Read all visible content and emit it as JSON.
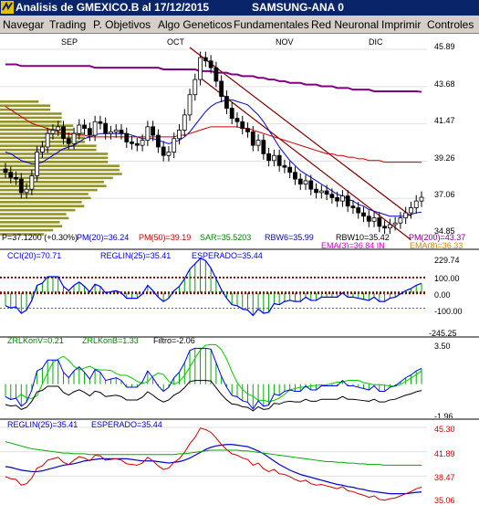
{
  "window": {
    "title": "Analisis de GMEXICO.B al 17/12/2015",
    "subtitle": "SAMSUNG-ANA 0"
  },
  "menu": [
    "Navegar",
    "Trading",
    "P. Objetivos",
    "Algo Geneticos",
    "Fundamentales",
    "Red Neuronal",
    "Imprimir",
    "Controles"
  ],
  "months": [
    "SEP",
    "OCT",
    "NOV",
    "DIC"
  ],
  "price_panel": {
    "y_ticks": [
      "45.89",
      "43.68",
      "41.47",
      "39.26",
      "37.06",
      "34.85"
    ],
    "info_row": [
      "P=37.1200 (+0.30%)",
      "PM(20)=36.24",
      "PM(50)=39.19",
      "SAR=35.5203",
      "RBW6=35.99",
      "RBW10=35.42",
      "PM(200)=43.37"
    ],
    "info_row2": [
      "EMA(3)=36.84 IN",
      "EMA(8)=36.33"
    ]
  },
  "cci_panel": {
    "labels": [
      "CCI(20)=70.71",
      "REGLIN(25)=35.41",
      "ESPERADO=35.44"
    ],
    "y_ticks": [
      "229.74",
      "100.00",
      "0.00",
      "-100.00",
      "-245.25"
    ]
  },
  "zrl_panel": {
    "labels": [
      "ZRLKonV=0.21",
      "ZRLKonB=1.33",
      "Filtro=-2.06"
    ],
    "y_ticks": [
      "3.50",
      "-1.96"
    ]
  },
  "reg_panel": {
    "labels": [
      "REGLIN(25)=35.41",
      "ESPERADO=35.44"
    ],
    "y_ticks": [
      "45.30",
      "41.89",
      "38.47",
      "35.06"
    ]
  },
  "chart_data": {
    "type": "line",
    "title": "Analisis de GMEXICO.B al 17/12/2015",
    "x_labels": [
      "SEP",
      "OCT",
      "NOV",
      "DIC"
    ],
    "ylim": [
      34.85,
      45.89
    ],
    "close": [
      38.6,
      38.3,
      38.2,
      37.4,
      37.6,
      38.4,
      39.8,
      40.1,
      40.9,
      41.1,
      41.3,
      40.6,
      40.3,
      40.9,
      41.4,
      41.2,
      40.8,
      41.6,
      41.5,
      40.9,
      41.0,
      41.1,
      40.9,
      40.4,
      40.3,
      40.2,
      40.5,
      41.3,
      40.8,
      40.1,
      39.6,
      39.8,
      40.6,
      41.1,
      42.0,
      43.2,
      44.1,
      45.4,
      45.2,
      44.8,
      44.0,
      43.1,
      42.4,
      41.8,
      41.6,
      41.2,
      41.0,
      40.2,
      40.5,
      39.7,
      39.3,
      39.6,
      39.0,
      38.9,
      38.6,
      38.2,
      37.9,
      38.1,
      37.6,
      37.4,
      37.5,
      37.3,
      37.1,
      36.9,
      37.2,
      36.6,
      36.5,
      36.2,
      36.0,
      35.7,
      35.9,
      35.4,
      35.3,
      35.5,
      35.6,
      35.9,
      36.2,
      36.5,
      36.9,
      37.12
    ],
    "series": [
      {
        "name": "PM(20)",
        "color": "#0000cc",
        "values": [
          39.8,
          39.7,
          39.5,
          39.3,
          39.2,
          39.1,
          39.1,
          39.2,
          39.4,
          39.6,
          39.8,
          40.0,
          40.1,
          40.2,
          40.4,
          40.6,
          40.7,
          40.8,
          40.9,
          40.9,
          40.9,
          40.9,
          40.9,
          40.9,
          40.8,
          40.7,
          40.6,
          40.6,
          40.6,
          40.5,
          40.4,
          40.3,
          40.4,
          40.5,
          40.7,
          41.0,
          41.4,
          41.8,
          42.2,
          42.5,
          42.7,
          42.8,
          42.9,
          42.9,
          42.8,
          42.7,
          42.6,
          42.3,
          42.0,
          41.6,
          41.1,
          40.6,
          40.1,
          39.7,
          39.3,
          39.0,
          38.7,
          38.5,
          38.3,
          38.1,
          37.9,
          37.7,
          37.5,
          37.3,
          37.2,
          37.0,
          36.9,
          36.7,
          36.6,
          36.4,
          36.3,
          36.2,
          36.1,
          36.0,
          36.0,
          36.0,
          36.0,
          36.1,
          36.2,
          36.24
        ]
      },
      {
        "name": "PM(50)",
        "color": "#cc0000",
        "values": [
          42.5,
          42.3,
          42.1,
          41.9,
          41.7,
          41.5,
          41.4,
          41.3,
          41.2,
          41.1,
          41.0,
          40.9,
          40.9,
          40.8,
          40.8,
          40.8,
          40.7,
          40.7,
          40.7,
          40.7,
          40.7,
          40.7,
          40.7,
          40.7,
          40.7,
          40.7,
          40.7,
          40.7,
          40.7,
          40.7,
          40.7,
          40.7,
          40.7,
          40.8,
          40.8,
          40.9,
          41.0,
          41.1,
          41.2,
          41.3,
          41.3,
          41.3,
          41.3,
          41.3,
          41.3,
          41.2,
          41.2,
          41.1,
          41.0,
          40.9,
          40.8,
          40.7,
          40.6,
          40.5,
          40.4,
          40.3,
          40.2,
          40.1,
          40.0,
          39.9,
          39.8,
          39.7,
          39.7,
          39.6,
          39.6,
          39.5,
          39.5,
          39.4,
          39.4,
          39.3,
          39.3,
          39.3,
          39.2,
          39.2,
          39.2,
          39.2,
          39.2,
          39.2,
          39.2,
          39.19
        ]
      },
      {
        "name": "PM(200)",
        "color": "#800080",
        "values": [
          45.0,
          45.0,
          45.0,
          44.9,
          44.9,
          44.9,
          44.9,
          44.9,
          44.9,
          44.9,
          44.9,
          44.9,
          44.9,
          44.9,
          44.9,
          44.9,
          44.9,
          44.8,
          44.8,
          44.8,
          44.8,
          44.8,
          44.8,
          44.8,
          44.8,
          44.8,
          44.8,
          44.8,
          44.8,
          44.8,
          44.7,
          44.7,
          44.7,
          44.7,
          44.7,
          44.7,
          44.7,
          44.6,
          44.6,
          44.6,
          44.5,
          44.5,
          44.5,
          44.4,
          44.4,
          44.3,
          44.3,
          44.3,
          44.2,
          44.2,
          44.1,
          44.1,
          44.0,
          44.0,
          43.9,
          43.9,
          43.9,
          43.8,
          43.8,
          43.8,
          43.7,
          43.7,
          43.7,
          43.6,
          43.6,
          43.6,
          43.5,
          43.5,
          43.5,
          43.5,
          43.4,
          43.4,
          43.4,
          43.4,
          43.4,
          43.4,
          43.4,
          43.4,
          43.4,
          43.37
        ]
      }
    ]
  },
  "colors": {
    "title_bg": "#0a246a",
    "menu_bg": "#d4d0c8",
    "volume_profile": "#808000",
    "channel": "#800000",
    "ma20": "#0000cc",
    "ma50": "#cc0000",
    "ma200": "#800080",
    "cci_line": "#0000ff",
    "zrl_green": "#00aa00",
    "reg_blue": "#0000cc",
    "reg_red": "#cc0000"
  }
}
